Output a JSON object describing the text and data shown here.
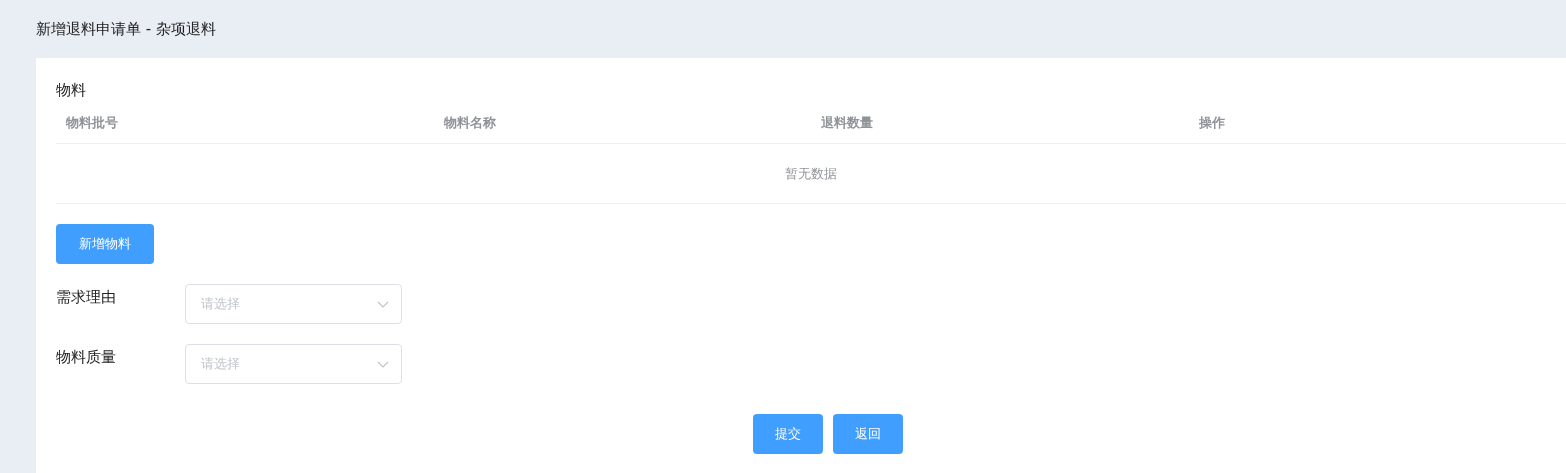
{
  "page_title": "新增退料申请单 - 杂项退料",
  "section_title": "物料",
  "table": {
    "columns": [
      "物料批号",
      "物料名称",
      "退料数量",
      "操作"
    ],
    "empty_text": "暂无数据"
  },
  "add_button": "新增物料",
  "form": [
    {
      "label": "需求理由",
      "placeholder": "请选择"
    },
    {
      "label": "物料质量",
      "placeholder": "请选择"
    }
  ],
  "buttons": [
    "提交",
    "返回"
  ]
}
